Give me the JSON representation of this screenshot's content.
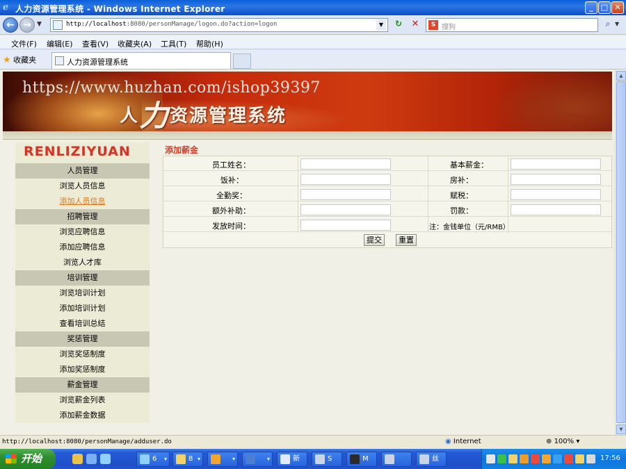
{
  "window": {
    "title": "人力资源管理系统 - Windows Internet Explorer",
    "ie_icon": "ie-icon",
    "controls": {
      "minimize": "_",
      "maximize": "□",
      "close": "✕"
    }
  },
  "navigation": {
    "back": "←",
    "forward": "→",
    "address_host": "http://localhost",
    "address_rest": ":8080/personManage/logon.do?action=logon",
    "refresh": "↻",
    "stop": "✕",
    "search_engine_icon": "S",
    "search_placeholder": "搜狗",
    "search_go": "⌕"
  },
  "menubar": {
    "items": [
      "文件(F)",
      "编辑(E)",
      "查看(V)",
      "收藏夹(A)",
      "工具(T)",
      "帮助(H)"
    ]
  },
  "favorites": {
    "label": "收藏夹",
    "tab_title": "人力资源管理系统"
  },
  "banner": {
    "title_prefix": "人",
    "title_big": "力",
    "title_rest": "资源管理系统",
    "watermark": "https://www.huzhan.com/ishop39397"
  },
  "sidebar": {
    "brand": "RENLIZIYUAN",
    "sections": [
      {
        "heading": "人员管理",
        "items": [
          "浏览人员信息",
          "添加人员信息"
        ]
      },
      {
        "heading": "招聘管理",
        "items": [
          "浏览应聘信息",
          "添加应聘信息",
          "浏览人才库"
        ]
      },
      {
        "heading": "培训管理",
        "items": [
          "浏览培训计划",
          "添加培训计划",
          "查看培训总结"
        ]
      },
      {
        "heading": "奖惩管理",
        "items": [
          "浏览奖惩制度",
          "添加奖惩制度"
        ]
      },
      {
        "heading": "薪金管理",
        "items": [
          "浏览薪金列表",
          "添加薪金数据"
        ]
      }
    ],
    "active_item": "添加人员信息"
  },
  "form": {
    "title": "添加薪金",
    "rows": [
      {
        "left_label": "员工姓名：",
        "left_value": "",
        "right_label": "基本薪金：",
        "right_value": ""
      },
      {
        "left_label": "饭补：",
        "left_value": "",
        "right_label": "房补：",
        "right_value": ""
      },
      {
        "left_label": "全勤奖：",
        "left_value": "",
        "right_label": "赋税：",
        "right_value": ""
      },
      {
        "left_label": "额外补助：",
        "left_value": "",
        "right_label": "罚款：",
        "right_value": ""
      },
      {
        "left_label": "发放时间：",
        "left_value": "",
        "note": "注：金钱单位（元/RMB）"
      }
    ],
    "submit_label": "提交",
    "reset_label": "重置"
  },
  "statusbar": {
    "url": "http://localhost:8080/personManage/adduser.do",
    "zone": "Internet",
    "zoom": "100%"
  },
  "taskbar": {
    "start_label": "开始",
    "tasks": [
      {
        "label": "6",
        "icon": "ie-icon"
      },
      {
        "label": "8",
        "icon": "folder-icon"
      },
      {
        "label": "",
        "icon": "qq-icon"
      },
      {
        "label": "",
        "icon": "word-icon"
      },
      {
        "label": "新",
        "icon": "doc-icon"
      },
      {
        "label": "S",
        "icon": "app-icon"
      },
      {
        "label": "M",
        "icon": "terminal-icon"
      },
      {
        "label": "",
        "icon": "app-icon"
      },
      {
        "label": "丝",
        "icon": "app-icon"
      }
    ],
    "clock": "17:56",
    "colors": {
      "start": "#2e8f2e",
      "taskbar": "#2459d6",
      "tray": "#0f75dc"
    }
  },
  "theme": {
    "banner_red": "#c32a0a",
    "brand_red": "#d0362a",
    "sidebar_bg": "#ecebd6",
    "sidebar_head": "#c8c7b4",
    "active_link": "#e0781a"
  }
}
